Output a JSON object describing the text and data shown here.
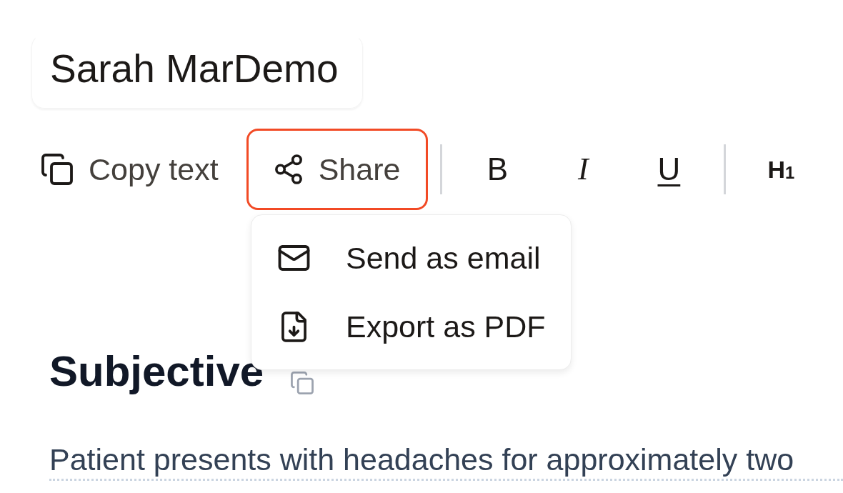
{
  "title_field": {
    "value": "Sarah MarDemo"
  },
  "toolbar": {
    "actions": [
      {
        "kind": "copy",
        "label": "Copy text",
        "highlighted": false
      },
      {
        "kind": "share",
        "label": "Share",
        "highlighted": true
      }
    ],
    "format_groups": [
      {
        "buttons": [
          {
            "kind": "bold",
            "label": "B"
          },
          {
            "kind": "italic",
            "label": "I"
          },
          {
            "kind": "underline",
            "label": "U"
          }
        ]
      },
      {
        "buttons": [
          {
            "kind": "heading",
            "label": "H$_{1}$"
          }
        ]
      }
    ]
  },
  "share_menu": {
    "items": [
      {
        "kind": "email",
        "label": "Send as email"
      },
      {
        "kind": "pdf",
        "label": "Export as PDF"
      }
    ]
  },
  "section": {
    "heading": "Subjective",
    "paragraph": "Patient presents with headaches for approximately two"
  }
}
